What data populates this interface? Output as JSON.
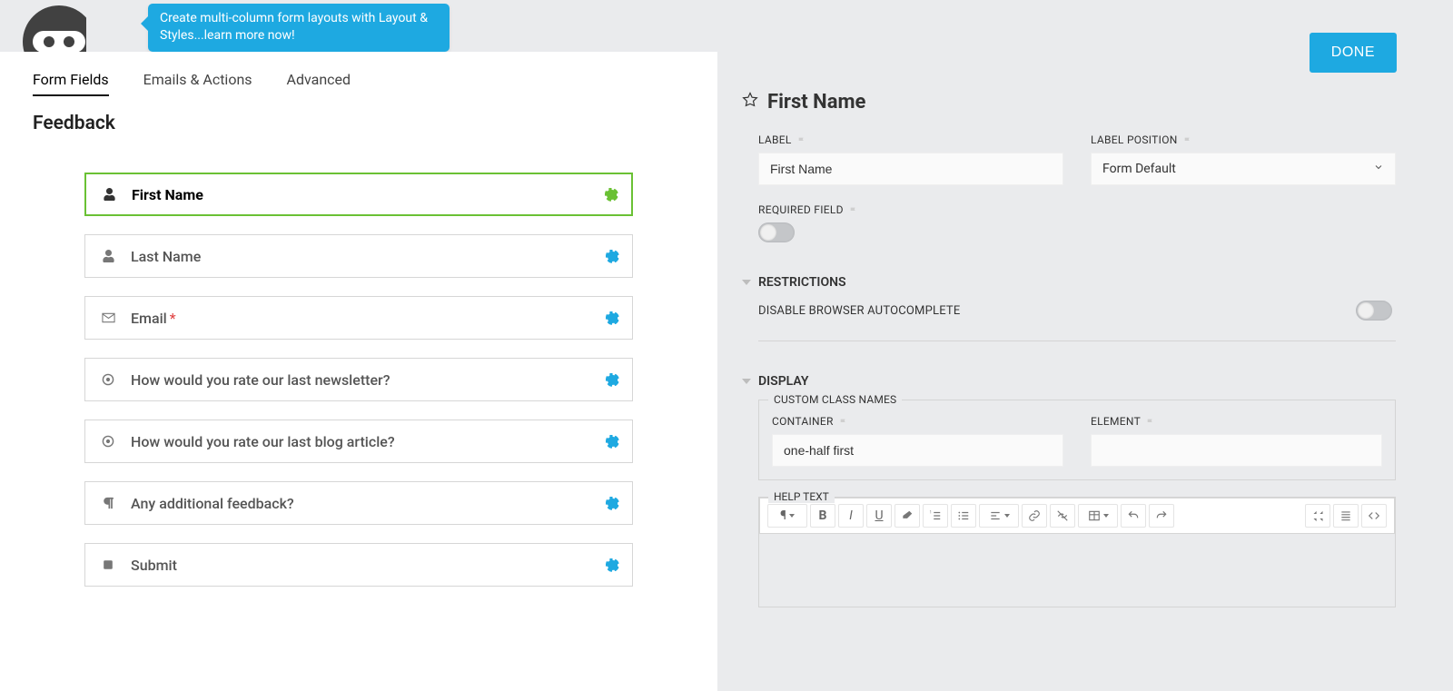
{
  "banner": {
    "tooltip": "Create multi-column form layouts with Layout & Styles...learn more now!"
  },
  "buttons": {
    "done": "DONE"
  },
  "tabs": {
    "form_fields": "Form Fields",
    "emails_actions": "Emails & Actions",
    "advanced": "Advanced"
  },
  "form": {
    "title": "Feedback"
  },
  "fields": [
    {
      "label": "First Name",
      "icon": "user",
      "selected": true
    },
    {
      "label": "Last Name",
      "icon": "user"
    },
    {
      "label": "Email",
      "icon": "mail",
      "required": true
    },
    {
      "label": "How would you rate our last newsletter?",
      "icon": "radio"
    },
    {
      "label": "How would you rate our last blog article?",
      "icon": "radio"
    },
    {
      "label": "Any additional feedback?",
      "icon": "paragraph"
    },
    {
      "label": "Submit",
      "icon": "square"
    }
  ],
  "editor": {
    "field_name": "First Name",
    "labels": {
      "label": "LABEL",
      "label_position": "LABEL POSITION",
      "required_field": "REQUIRED FIELD",
      "restrictions": "RESTRICTIONS",
      "disable_autocomplete": "DISABLE BROWSER AUTOCOMPLETE",
      "display": "DISPLAY",
      "custom_class_names": "CUSTOM CLASS NAMES",
      "container": "CONTAINER",
      "element": "ELEMENT",
      "help_text": "HELP TEXT"
    },
    "values": {
      "label": "First Name",
      "label_position": "Form Default",
      "required": false,
      "disable_autocomplete": false,
      "container_class": "one-half first",
      "element_class": ""
    }
  }
}
